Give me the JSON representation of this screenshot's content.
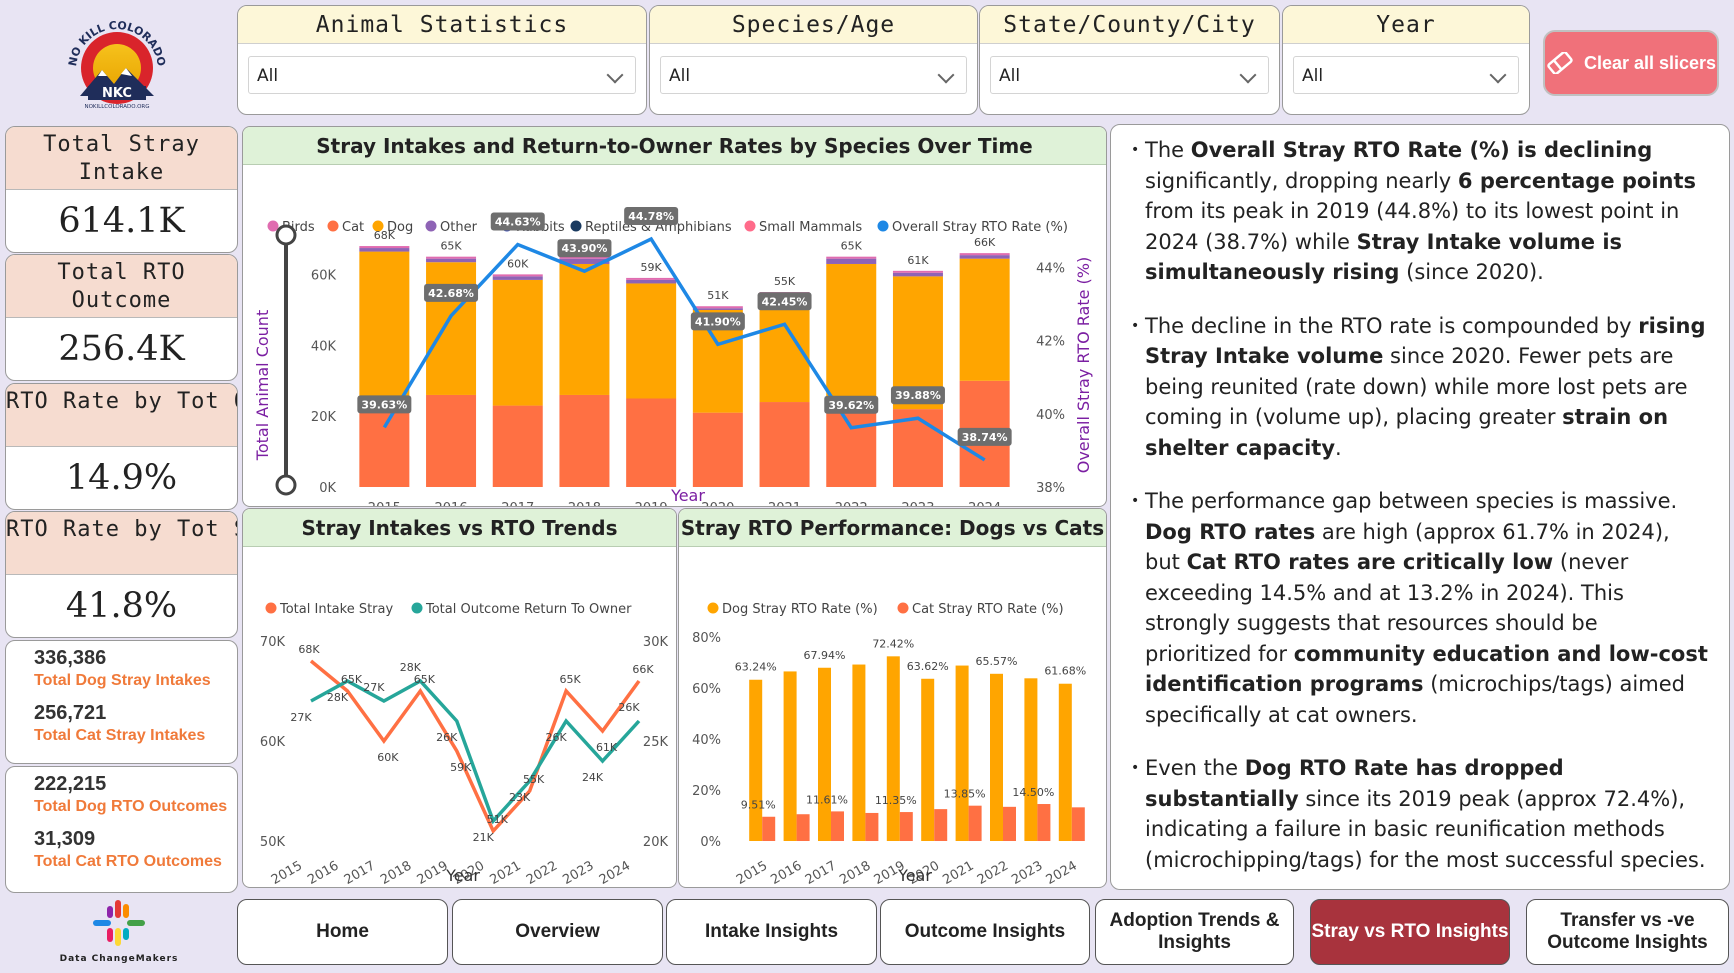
{
  "logo": {
    "text_top": "NO KILL COLORADO",
    "text_mid": "NKC",
    "url_text": "NOKILLCOLORADO.ORG"
  },
  "footer_logo": {
    "text": "Data ChangeMakers"
  },
  "slicers": [
    {
      "title": "Animal Statistics",
      "value": "All"
    },
    {
      "title": "Species/Age",
      "value": "All"
    },
    {
      "title": "State/County/City",
      "value": "All"
    },
    {
      "title": "Year",
      "value": "All"
    }
  ],
  "clear_button": {
    "label": "Clear all slicers"
  },
  "kpis": [
    {
      "title": "Total Stray Intake",
      "value": "614.1K"
    },
    {
      "title": "Total RTO Outcome",
      "value": "256.4K"
    },
    {
      "title": "RTO Rate by Tot Outcomes",
      "value": "14.9%"
    },
    {
      "title": "RTO Rate by Tot Stray IntakeS",
      "value": "41.8%"
    }
  ],
  "mini_stats": [
    [
      {
        "num": "336,386",
        "label": "Total Dog Stray Intakes"
      },
      {
        "num": "256,721",
        "label": "Total Cat Stray Intakes"
      }
    ],
    [
      {
        "num": "222,215",
        "label": "Total Dog RTO Outcomes"
      },
      {
        "num": "31,309",
        "label": "Total Cat RTO Outcomes"
      }
    ]
  ],
  "colors": {
    "dog": "#ffa500",
    "cat": "#ff7043",
    "rate_line": "#1e88e5",
    "teal": "#26a69a",
    "birds": "#e06cb0",
    "other": "#8e63b5",
    "rabbits": "#3f51b5",
    "reptiles": "#1a3a60",
    "small_mammals": "#ff6b8a"
  },
  "chart_data": [
    {
      "type": "bar",
      "stacked": true,
      "title": "Stray Intakes and Return-to-Owner Rates by Species Over Time",
      "xlabel": "Year",
      "ylabel": "Total Animal Count",
      "y2label": "Overall Stray RTO Rate (%)",
      "legend": [
        "Birds",
        "Cat",
        "Dog",
        "Other",
        "Rabbits",
        "Reptiles & Amphibians",
        "Small Mammals",
        "Overall Stray RTO Rate (%)"
      ],
      "categories": [
        "2015",
        "2016",
        "2017",
        "2018",
        "2019",
        "2020",
        "2021",
        "2022",
        "2023",
        "2024"
      ],
      "yticks": [
        "0K",
        "20K",
        "40K",
        "60K"
      ],
      "y2ticks": [
        "38%",
        "40%",
        "42%",
        "44%"
      ],
      "ylim": [
        0,
        70
      ],
      "y2lim": [
        38,
        45
      ],
      "totals": [
        68,
        65,
        60,
        65,
        59,
        51,
        55,
        65,
        61,
        66
      ],
      "total_labels": [
        "68K",
        "65K",
        "60K",
        "65K",
        "59K",
        "51K",
        "55K",
        "65K",
        "61K",
        "66K"
      ],
      "series": [
        {
          "name": "Cat",
          "values": [
            25,
            26,
            23,
            26,
            25,
            21,
            24,
            25,
            22,
            30
          ]
        },
        {
          "name": "Dog",
          "values": [
            41.5,
            37.5,
            35.5,
            37,
            32.5,
            29,
            29.5,
            38,
            37.5,
            34.5
          ]
        },
        {
          "name": "Other",
          "values": [
            1,
            1,
            1,
            1.5,
            1,
            0.5,
            1,
            1.5,
            1,
            1
          ]
        }
      ],
      "rate": [
        39.63,
        42.68,
        44.63,
        43.9,
        44.78,
        41.9,
        42.45,
        39.62,
        39.88,
        38.74
      ],
      "rate_labels": [
        "39.63%",
        "42.68%",
        "44.63%",
        "43.90%",
        "44.78%",
        "41.90%",
        "42.45%",
        "39.62%",
        "39.88%",
        "38.74%"
      ]
    },
    {
      "type": "line",
      "title": "Stray Intakes vs RTO Trends",
      "xlabel": "Year",
      "legend": [
        "Total Intake Stray",
        "Total Outcome Return To Owner"
      ],
      "categories": [
        "2015",
        "2016",
        "2017",
        "2018",
        "2019",
        "2020",
        "2021",
        "2022",
        "2023",
        "2024"
      ],
      "yticks": [
        "50K",
        "60K",
        "70K"
      ],
      "y2ticks": [
        "20K",
        "25K",
        "30K"
      ],
      "ylim": [
        50,
        70
      ],
      "y2lim": [
        20,
        30
      ],
      "series": [
        {
          "name": "Total Intake Stray",
          "values": [
            68,
            65,
            60,
            65,
            59,
            51,
            55,
            65,
            61,
            66
          ]
        },
        {
          "name": "Total Outcome Return To Owner",
          "values": [
            27,
            28,
            27,
            28,
            26,
            21,
            23,
            26,
            24,
            26
          ]
        }
      ],
      "labels1": [
        "68K",
        "65K",
        "60K",
        "65K",
        "59K",
        "51K",
        "55K",
        "65K",
        "61K",
        "66K"
      ],
      "labels2": [
        "27K",
        "28K",
        "27K",
        "28K",
        "26K",
        "21K",
        "23K",
        "26K",
        "24K",
        "26K"
      ]
    },
    {
      "type": "bar",
      "title": "Stray RTO Performance: Dogs vs Cats",
      "xlabel": "Year",
      "legend": [
        "Dog Stray RTO Rate (%)",
        "Cat Stray RTO Rate (%)"
      ],
      "categories": [
        "2015",
        "2016",
        "2017",
        "2018",
        "2019",
        "2020",
        "2021",
        "2022",
        "2023",
        "2024"
      ],
      "yticks": [
        "0%",
        "20%",
        "40%",
        "60%",
        "80%"
      ],
      "ylim": [
        0,
        80
      ],
      "series": [
        {
          "name": "Dog Stray RTO Rate (%)",
          "values": [
            63.24,
            66.5,
            67.94,
            69.2,
            72.42,
            63.62,
            68.8,
            65.57,
            63.8,
            61.68
          ]
        },
        {
          "name": "Cat Stray RTO Rate (%)",
          "values": [
            9.51,
            10.5,
            11.61,
            11.0,
            11.35,
            12.5,
            13.85,
            13.4,
            14.5,
            13.2
          ]
        }
      ],
      "dog_labels": [
        "63.24%",
        "",
        "67.94%",
        "",
        "72.42%",
        "63.62%",
        "",
        "65.57%",
        "",
        "61.68%"
      ],
      "cat_labels": [
        "9.51%",
        "",
        "11.61%",
        "",
        "11.35%",
        "",
        "13.85%",
        "",
        "14.50%",
        ""
      ]
    }
  ],
  "insights": [
    "The <b>Overall Stray RTO Rate (%) is declining</b> significantly, dropping nearly <b>6 percentage points</b> from its peak in 2019 (44.8%) to its lowest point in 2024 (38.7%) while <b>Stray Intake volume is simultaneously rising</b> (since 2020).",
    "The decline in the RTO rate is compounded by <b>rising Stray Intake volume</b> since 2020. Fewer pets are being reunited (rate down) while more lost pets are coming in (volume up), placing greater <b>strain on shelter capacity</b>.",
    "The performance gap between species is massive. <b>Dog RTO rates</b> are high (approx 61.7% in 2024), but <b>Cat RTO rates are critically low</b> (never exceeding 14.5% and at 13.2% in 2024). This strongly suggests that resources should be prioritized for <b>community education and low-cost identification programs</b> (microchips/tags) aimed specifically at cat owners.",
    "Even the <b>Dog RTO Rate has dropped substantially</b> since its 2019 peak (approx 72.4%), indicating a failure in basic reunification methods (microchipping/tags) for the most successful species."
  ],
  "nav": [
    {
      "label": "Home"
    },
    {
      "label": "Overview"
    },
    {
      "label": "Intake Insights"
    },
    {
      "label": "Outcome Insights"
    },
    {
      "label": "Adoption Trends & Insights"
    },
    {
      "label": "Stray vs RTO Insights",
      "active": true
    },
    {
      "label": "Transfer vs -ve Outcome Insights"
    }
  ]
}
